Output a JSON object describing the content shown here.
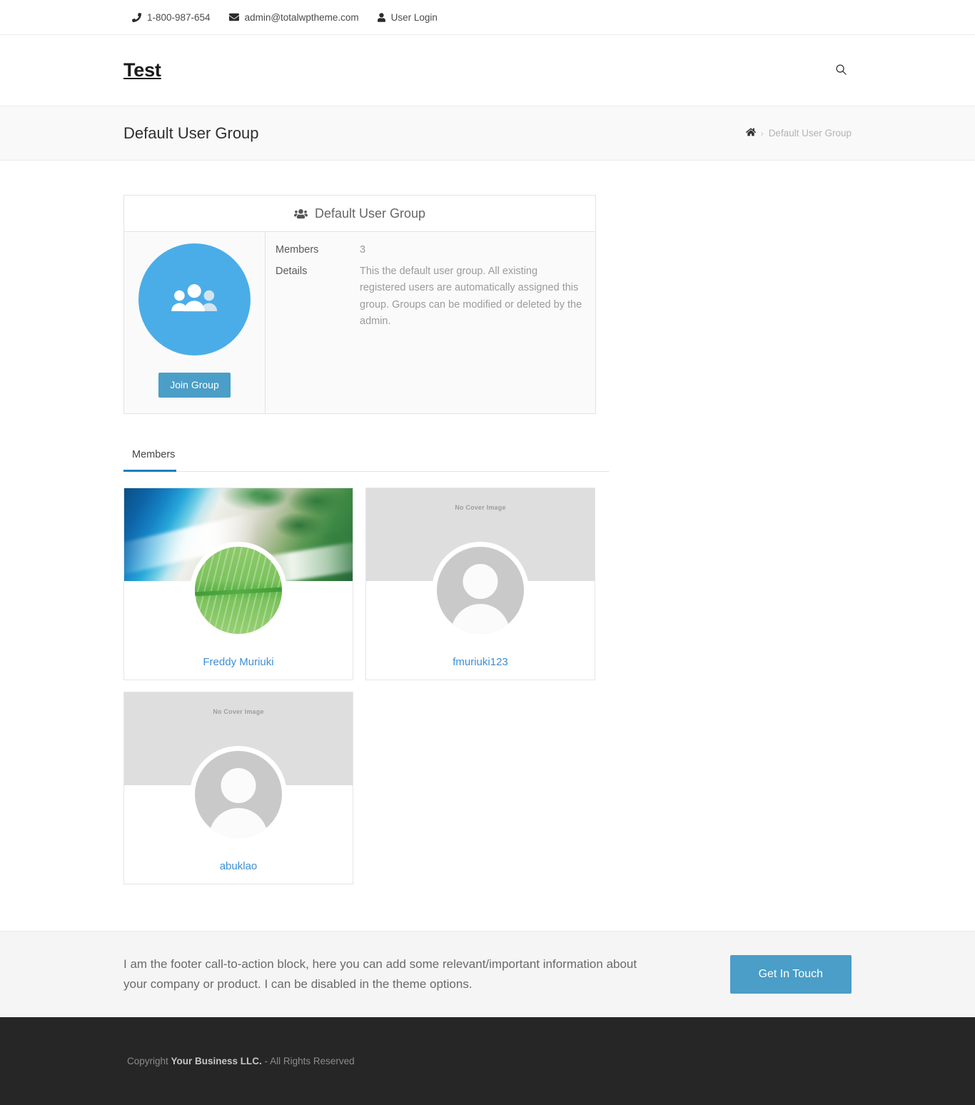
{
  "topbar": {
    "phone": "1-800-987-654",
    "email": "admin@totalwptheme.com",
    "login": "User Login",
    "icons": {
      "phone": "phone-icon",
      "email": "envelope-icon",
      "login": "user-icon"
    }
  },
  "header": {
    "site_title": "Test",
    "search_icon": "search-icon"
  },
  "titlebar": {
    "page_title": "Default User Group",
    "breadcrumb": {
      "home_icon": "home-icon",
      "separator": "›",
      "current": "Default User Group"
    }
  },
  "group": {
    "card_title": "Default User Group",
    "card_icon": "users-group-icon",
    "avatar_icon": "group-people-icon",
    "avatar_bg": "#4aade8",
    "join_button": "Join Group",
    "details": [
      {
        "label": "Members",
        "value": "3"
      },
      {
        "label": "Details",
        "value": "This the default user group. All existing registered users are automatically assigned this group. Groups can be modified or deleted by the admin."
      }
    ]
  },
  "tabs": [
    {
      "label": "Members",
      "active": true
    }
  ],
  "members": [
    {
      "name": "Freddy Muriuki",
      "cover_type": "image",
      "cover_label": "",
      "avatar_type": "image"
    },
    {
      "name": "fmuriuki123",
      "cover_type": "placeholder",
      "cover_label": "No Cover Image",
      "avatar_type": "default"
    },
    {
      "name": "abuklao",
      "cover_type": "placeholder",
      "cover_label": "No Cover Image",
      "avatar_type": "default"
    }
  ],
  "cta": {
    "text": "I am the footer call-to-action block, here you can add some relevant/important information about your company or product. I can be disabled in the theme options.",
    "button": "Get In Touch",
    "button_color": "#4a9ec7"
  },
  "footer": {
    "copyright_prefix": "Copyright ",
    "copyright_business": "Your Business LLC.",
    "copyright_suffix": " - All Rights Reserved"
  }
}
